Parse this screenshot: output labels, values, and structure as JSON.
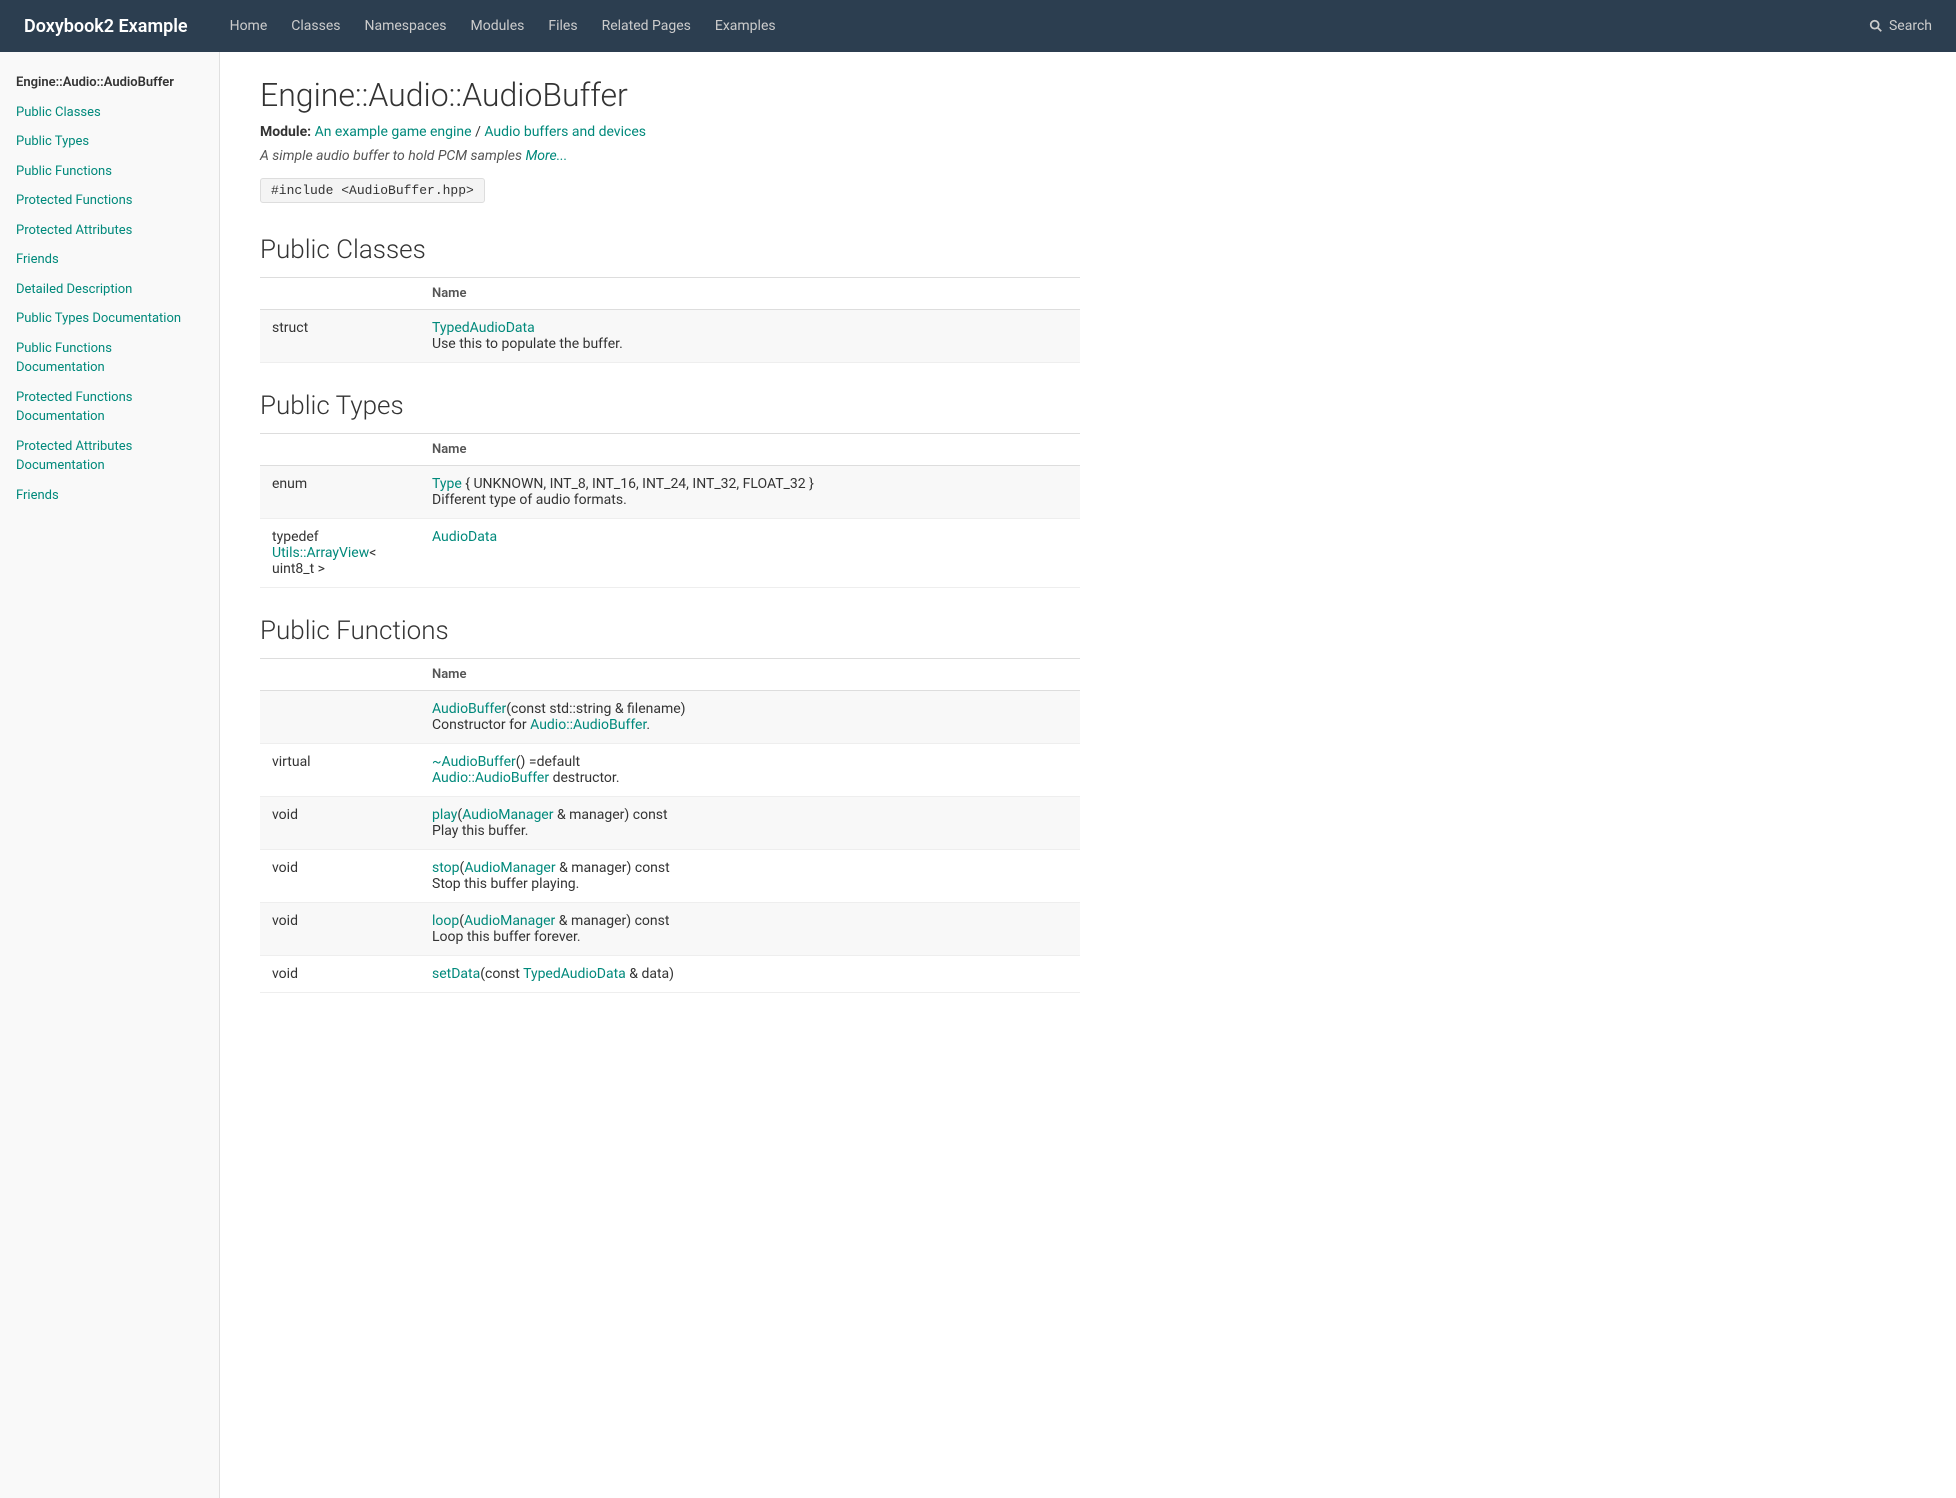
{
  "navbar": {
    "brand": "Doxybook2 Example",
    "links": [
      {
        "label": "Home",
        "href": "#"
      },
      {
        "label": "Classes",
        "href": "#"
      },
      {
        "label": "Namespaces",
        "href": "#"
      },
      {
        "label": "Modules",
        "href": "#"
      },
      {
        "label": "Files",
        "href": "#"
      },
      {
        "label": "Related Pages",
        "href": "#"
      },
      {
        "label": "Examples",
        "href": "#"
      }
    ],
    "search_label": "Search"
  },
  "sidebar": {
    "items": [
      {
        "label": "Engine::Audio::AudioBuffer",
        "href": "#",
        "active": true
      },
      {
        "label": "Public Classes",
        "href": "#public-classes"
      },
      {
        "label": "Public Types",
        "href": "#public-types"
      },
      {
        "label": "Public Functions",
        "href": "#public-functions"
      },
      {
        "label": "Protected Functions",
        "href": "#protected-functions"
      },
      {
        "label": "Protected Attributes",
        "href": "#protected-attributes"
      },
      {
        "label": "Friends",
        "href": "#friends"
      },
      {
        "label": "Detailed Description",
        "href": "#detailed-description"
      },
      {
        "label": "Public Types Documentation",
        "href": "#public-types-doc"
      },
      {
        "label": "Public Functions Documentation",
        "href": "#public-functions-doc"
      },
      {
        "label": "Protected Functions Documentation",
        "href": "#protected-functions-doc"
      },
      {
        "label": "Protected Attributes Documentation",
        "href": "#protected-attributes-doc"
      },
      {
        "label": "Friends",
        "href": "#friends-doc"
      }
    ]
  },
  "main": {
    "title": "Engine::Audio::AudioBuffer",
    "module_prefix": "Module:",
    "module_links": [
      {
        "label": "An example game engine",
        "href": "#"
      },
      {
        "label": "Audio buffers and devices",
        "href": "#"
      }
    ],
    "brief": "A simple audio buffer to hold PCM samples",
    "brief_more": "More...",
    "include": "#include <AudioBuffer.hpp>",
    "sections": {
      "public_classes": {
        "heading": "Public Classes",
        "col_name": "Name",
        "rows": [
          {
            "qualifier": "struct",
            "name_link": "TypedAudioData",
            "name_href": "#",
            "desc": "Use this to populate the buffer."
          }
        ]
      },
      "public_types": {
        "heading": "Public Types",
        "col_name": "Name",
        "rows": [
          {
            "qualifier": "enum",
            "name_prefix": "Type",
            "name_link": "Type",
            "name_href": "#",
            "name_suffix": "{ UNKNOWN, INT_8, INT_16, INT_24, INT_32, FLOAT_32 }",
            "desc": "Different type of audio formats."
          },
          {
            "qualifier": "typedef Utils::ArrayView< uint8_t >",
            "qualifier_link": "Utils::ArrayView",
            "qualifier_href": "#",
            "qualifier_suffix": "< uint8_t >",
            "name_link": "AudioData",
            "name_href": "#",
            "desc": ""
          }
        ]
      },
      "public_functions": {
        "heading": "Public Functions",
        "col_name": "Name",
        "rows": [
          {
            "qualifier": "",
            "name_link": "AudioBuffer",
            "name_href": "#",
            "name_suffix": "(const std::string & filename)",
            "desc": "Constructor for",
            "desc_link": "Audio::AudioBuffer",
            "desc_link_href": "#",
            "desc_suffix": "."
          },
          {
            "qualifier": "virtual",
            "name_link": "~AudioBuffer",
            "name_href": "#",
            "name_suffix": "() =default",
            "desc": "",
            "desc_link": "Audio::AudioBuffer",
            "desc_link_href": "#",
            "desc_suffix": " destructor."
          },
          {
            "qualifier": "void",
            "name_link": "play",
            "name_href": "#",
            "name_link2": "AudioManager",
            "name_href2": "#",
            "name_suffix": "(AudioManager & manager) const",
            "desc": "Play this buffer."
          },
          {
            "qualifier": "void",
            "name_link": "stop",
            "name_href": "#",
            "name_link2": "AudioManager",
            "name_href2": "#",
            "name_suffix": "(AudioManager & manager) const",
            "desc": "Stop this buffer playing."
          },
          {
            "qualifier": "void",
            "name_link": "loop",
            "name_href": "#",
            "name_link2": "AudioManager",
            "name_href2": "#",
            "name_suffix": "(AudioManager & manager) const",
            "desc": "Loop this buffer forever."
          },
          {
            "qualifier": "void",
            "name_link": "setData",
            "name_href": "#",
            "name_link2": "TypedAudioData",
            "name_href2": "#",
            "name_suffix": "(const TypedAudioData & data)",
            "desc": ""
          }
        ]
      }
    }
  }
}
